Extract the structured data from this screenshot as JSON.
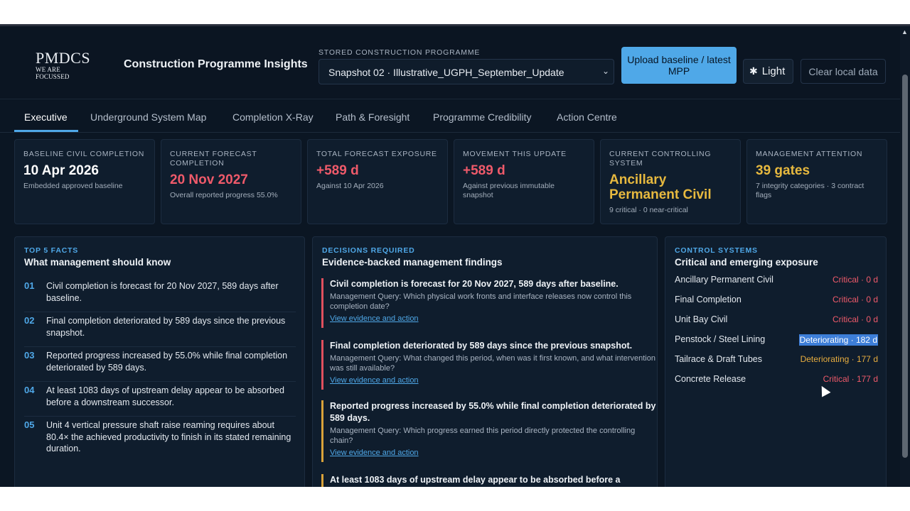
{
  "header": {
    "logo_main": "PMDCS",
    "logo_sub": "WE ARE FOCUSSED",
    "app_title": "Construction Programme Insights",
    "programme_label": "STORED CONSTRUCTION PROGRAMME",
    "programme_selected": "Snapshot 02 · Illustrative_UGPH_September_Update",
    "upload_label": "Upload baseline / latest MPP",
    "light_label": "Light",
    "clear_label": "Clear local data"
  },
  "tabs": [
    "Executive",
    "Underground System Map",
    "Completion X-Ray",
    "Path & Foresight",
    "Programme Credibility",
    "Action Centre"
  ],
  "kpis": [
    {
      "label": "Baseline civil completion",
      "value": "10 Apr 2026",
      "sub": "Embedded approved baseline",
      "color": "#ffffff"
    },
    {
      "label": "Current forecast completion",
      "value": "20 Nov 2027",
      "sub": "Overall reported progress 55.0%",
      "color": "#ef5a6a"
    },
    {
      "label": "Total forecast exposure",
      "value": "+589 d",
      "sub": "Against 10 Apr 2026",
      "color": "#ef5a6a"
    },
    {
      "label": "Movement this update",
      "value": "+589 d",
      "sub": "Against previous immutable snapshot",
      "color": "#ef5a6a"
    },
    {
      "label": "Current controlling system",
      "value": "Ancillary Permanent Civil",
      "sub": "9 critical · 0 near-critical",
      "color": "#e7b93f"
    },
    {
      "label": "Management attention",
      "value": "39 gates",
      "sub": "7 integrity categories · 3 contract flags",
      "color": "#e7b93f"
    }
  ],
  "facts": {
    "eyebrow": "TOP 5 FACTS",
    "title": "What management should know",
    "items": [
      {
        "num": "01",
        "text": "Civil completion is forecast for 20 Nov 2027, 589 days after baseline."
      },
      {
        "num": "02",
        "text": "Final completion deteriorated by 589 days since the previous snapshot."
      },
      {
        "num": "03",
        "text": "Reported progress increased by 55.0% while final completion deteriorated by 589 days."
      },
      {
        "num": "04",
        "text": "At least 1083 days of upstream delay appear to be absorbed before a downstream successor."
      },
      {
        "num": "05",
        "text": "Unit 4 vertical pressure shaft raise reaming requires about 80.4× the achieved productivity to finish in its stated remaining duration."
      }
    ]
  },
  "decisions": {
    "eyebrow": "DECISIONS REQUIRED",
    "title": "Evidence-backed management findings",
    "items": [
      {
        "title": "Civil completion is forecast for 20 Nov 2027, 589 days after baseline.",
        "query": "Management Query: Which physical work fronts and interface releases now control this completion date?",
        "link": "View evidence and action"
      },
      {
        "title": "Final completion deteriorated by 589 days since the previous snapshot.",
        "query": "Management Query: What changed this period, when was it first known, and what intervention was still available?",
        "link": "View evidence and action"
      },
      {
        "title": "Reported progress increased by 55.0% while final completion deteriorated by 589 days.",
        "query": "Management Query: Which progress earned this period directly protected the controlling chain?",
        "link": "View evidence and action"
      },
      {
        "title": "At least 1083 days of upstream delay appear to be absorbed before a",
        "query": "",
        "link": ""
      }
    ]
  },
  "systems": {
    "eyebrow": "CONTROL SYSTEMS",
    "title": "Critical and emerging exposure",
    "items": [
      {
        "name": "Ancillary Permanent Civil",
        "status": "Critical · 0 d"
      },
      {
        "name": "Final Completion",
        "status": "Critical · 0 d"
      },
      {
        "name": "Unit Bay Civil",
        "status": "Critical · 0 d"
      },
      {
        "name": "Penstock / Steel Lining",
        "status": "Deteriorating · 182 d"
      },
      {
        "name": "Tailrace & Draft Tubes",
        "status": "Deteriorating · 177 d"
      },
      {
        "name": "Concrete Release",
        "status": "Critical · 177 d"
      }
    ]
  },
  "icons": {
    "sun": "sun-icon",
    "chevron": "chevron-down-icon",
    "scroll_up": "arrow-up-icon"
  }
}
